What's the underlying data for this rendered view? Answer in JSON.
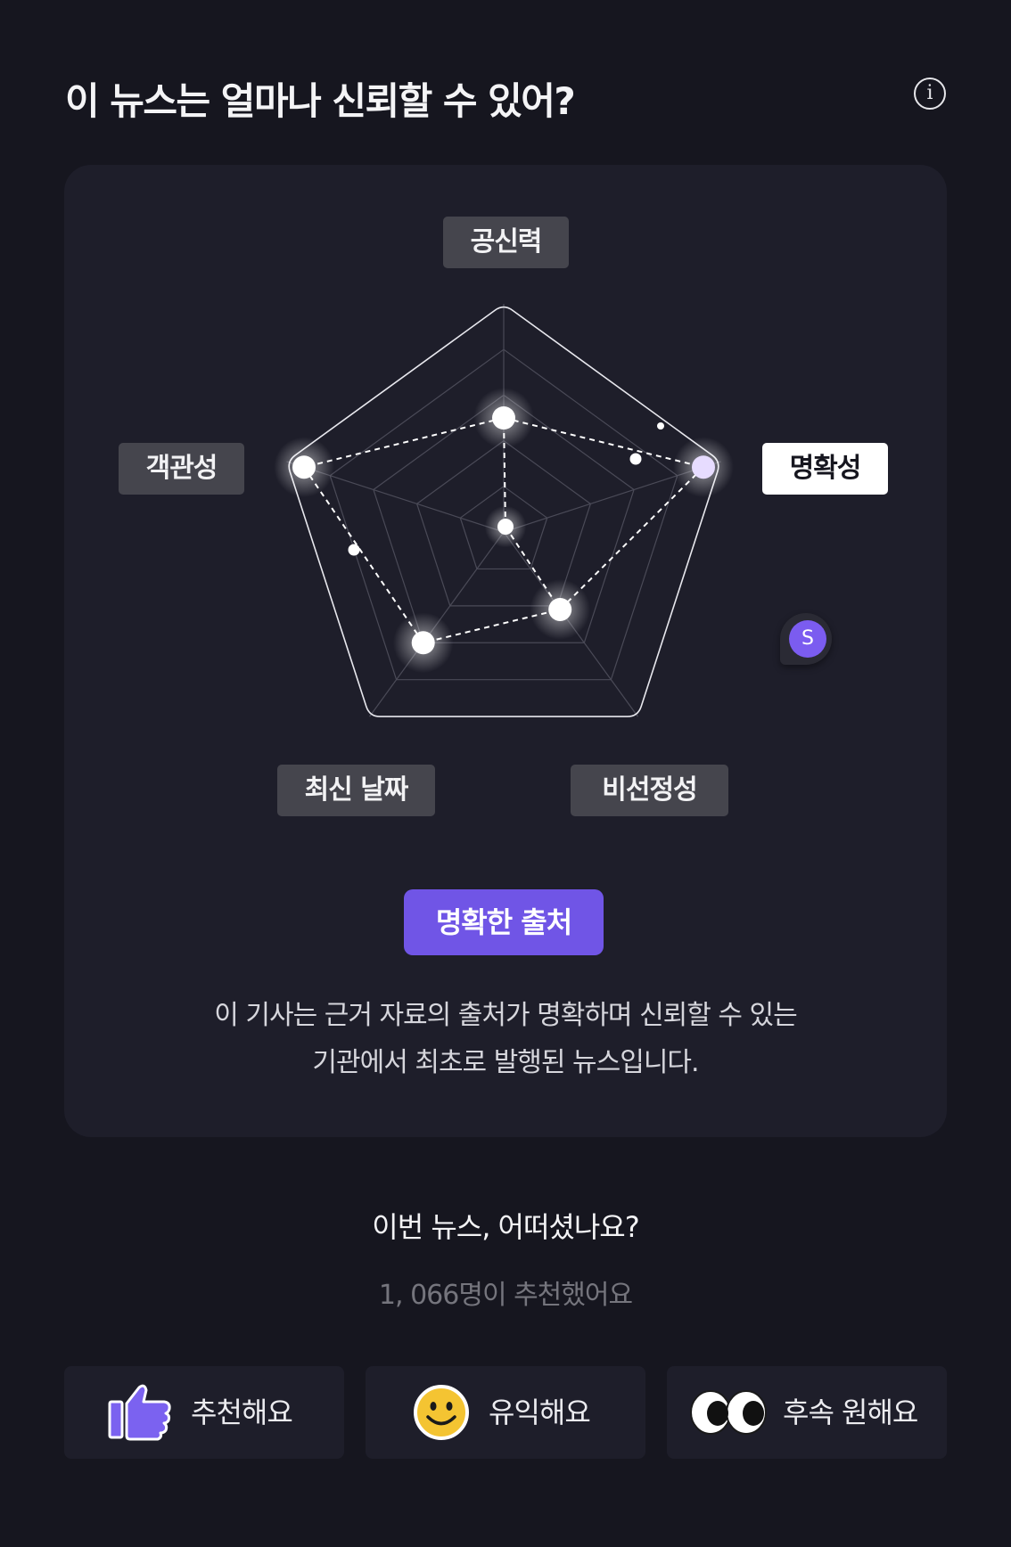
{
  "header": {
    "title": "이 뉴스는 얼마나 신뢰할 수 있어?",
    "info_icon": "i"
  },
  "radar": {
    "axes": [
      "공신력",
      "명확성",
      "비선정성",
      "최신 날짜",
      "객관성"
    ],
    "active_axis": "명확성",
    "values": [
      0.5,
      0.92,
      0.42,
      0.6,
      0.92
    ],
    "colors": {
      "grid": "#4a4a57",
      "outline": "#e8e8ee",
      "point": "#ffffff",
      "active_point": "#e7dcff",
      "accent": "#7055e6"
    }
  },
  "cursor": {
    "letter": "S"
  },
  "tag": {
    "label": "명확한 출처"
  },
  "description": {
    "line1": "이 기사는 근거 자료의 출처가 명확하며 신뢰할 수 있는",
    "line2": "기관에서 최초로 발행된 뉴스입니다."
  },
  "feedback": {
    "question": "이번 뉴스, 어떠셨나요?",
    "count": "1, 066명이 추천했어요",
    "buttons": [
      {
        "label": "추천해요",
        "icon": "thumbs-up-icon"
      },
      {
        "label": "유익해요",
        "icon": "smiley-icon"
      },
      {
        "label": "후속 원해요",
        "icon": "eyes-icon"
      }
    ]
  }
}
